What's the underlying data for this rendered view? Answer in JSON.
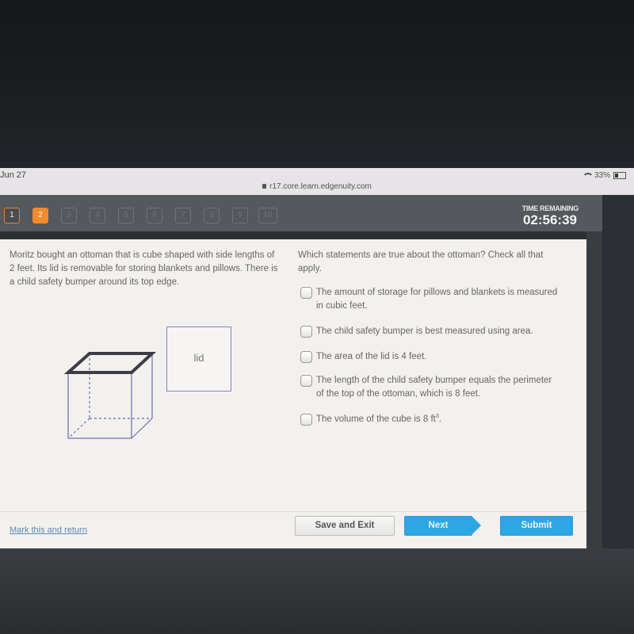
{
  "status_bar": {
    "date": "Jun 27",
    "url": "r17.core.learn.edgenuity.com",
    "battery": "33%"
  },
  "quiz_nav": {
    "questions": [
      {
        "label": "1",
        "state": "answered"
      },
      {
        "label": "2",
        "state": "current"
      },
      {
        "label": "3",
        "state": "unvisited"
      },
      {
        "label": "4",
        "state": "unvisited"
      },
      {
        "label": "5",
        "state": "unvisited"
      },
      {
        "label": "6",
        "state": "unvisited"
      },
      {
        "label": "7",
        "state": "unvisited"
      },
      {
        "label": "8",
        "state": "unvisited"
      },
      {
        "label": "9",
        "state": "unvisited"
      },
      {
        "label": "10",
        "state": "unvisited"
      }
    ],
    "timer_label": "TIME REMAINING",
    "timer_value": "02:56:39"
  },
  "question": {
    "stem": "Moritz bought an ottoman that is cube shaped with side lengths of 2 feet. Its lid is removable for storing blankets and pillows. There is a child safety bumper around its top edge.",
    "figure_lid_label": "lid",
    "prompt": "Which statements are true about the ottoman? Check all that apply.",
    "options": [
      {
        "text": "The amount of storage for pillows and blankets is measured in cubic feet.",
        "checked": false
      },
      {
        "text": "The child safety bumper is best measured using area.",
        "checked": false
      },
      {
        "text": "The area of the lid is 4 feet.",
        "checked": false
      },
      {
        "text": "The length of the child safety bumper equals the perimeter of the top of the ottoman, which is 8 feet.",
        "checked": false
      },
      {
        "text": "The volume of the cube is 8 ft",
        "sup": "3",
        "suffix": ".",
        "checked": false
      }
    ]
  },
  "footer": {
    "mark_link": "Mark this and return",
    "save_label": "Save and Exit",
    "next_label": "Next",
    "submit_label": "Submit"
  },
  "colors": {
    "accent_orange": "#f08a2c",
    "button_blue": "#2ea6e4",
    "link_blue": "#5b86b3"
  }
}
